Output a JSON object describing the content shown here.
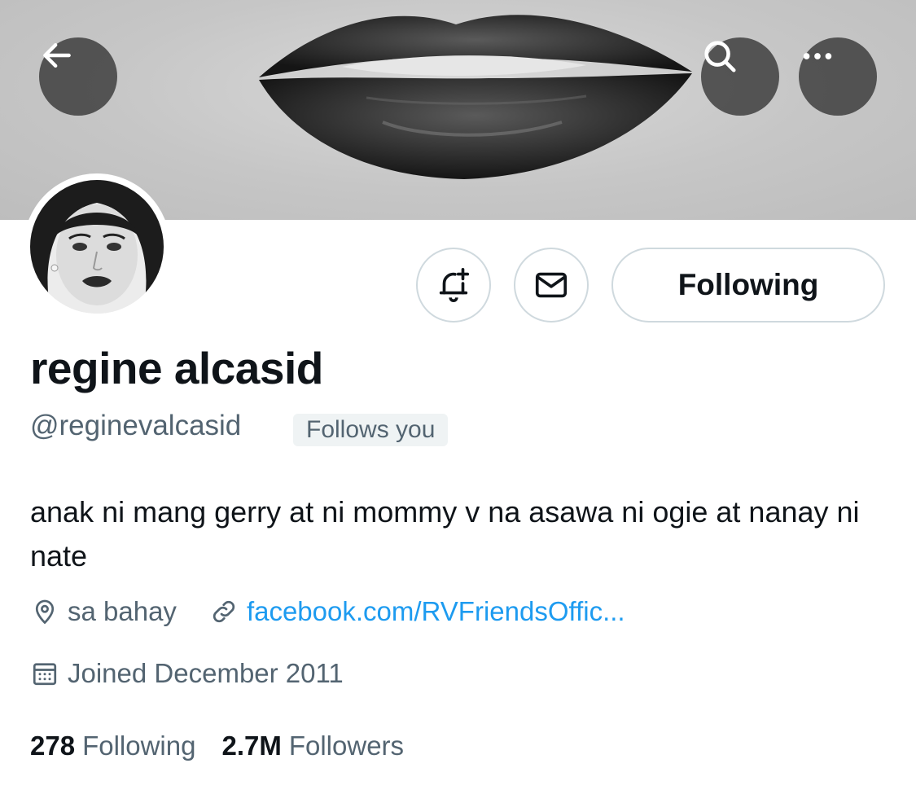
{
  "header": {
    "icons": {
      "back": "arrow-left-icon",
      "search": "search-icon",
      "more": "more-horizontal-icon"
    }
  },
  "profile": {
    "display_name": "regine alcasid",
    "handle": "@reginevalcasid",
    "follows_you_badge": "Follows you",
    "bio": "anak ni mang gerry at ni mommy v na asawa ni ogie at nanay ni nate",
    "location": "sa bahay",
    "website": "facebook.com/RVFriendsOffic...",
    "joined": "Joined December 2011"
  },
  "actions": {
    "following_label": "Following",
    "icons": {
      "notify": "bell-plus-icon",
      "message": "envelope-icon"
    }
  },
  "stats": {
    "following_count": "278",
    "following_label": "Following",
    "followers_count": "2.7M",
    "followers_label": "Followers"
  },
  "colors": {
    "text_primary": "#0f1419",
    "text_secondary": "#536471",
    "link": "#1d9bf0",
    "border": "#cfd9de",
    "badge_bg": "#eff3f4"
  }
}
